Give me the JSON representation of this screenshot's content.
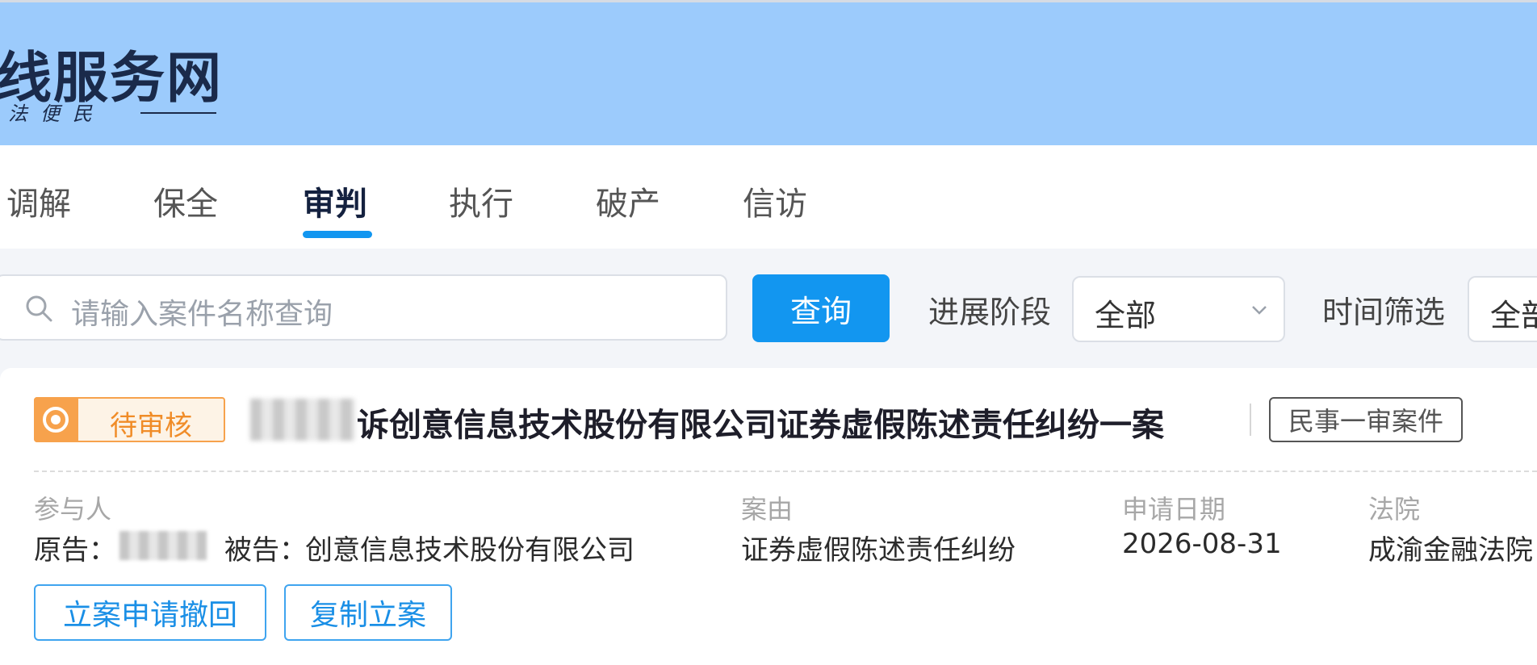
{
  "header": {
    "title": "线服务网",
    "slogan": "法便民"
  },
  "tabs": [
    {
      "label": "调解",
      "active": false
    },
    {
      "label": "保全",
      "active": false
    },
    {
      "label": "审判",
      "active": true
    },
    {
      "label": "执行",
      "active": false
    },
    {
      "label": "破产",
      "active": false
    },
    {
      "label": "信访",
      "active": false
    }
  ],
  "search": {
    "placeholder": "请输入案件名称查询",
    "button_label": "查询"
  },
  "filters": {
    "stage_label": "进展阶段",
    "stage_value": "全部",
    "time_label": "时间筛选",
    "time_value": "全部"
  },
  "case": {
    "status": "待审核",
    "title_suffix": "诉创意信息技术股份有限公司证券虚假陈述责任纠纷一案",
    "type_tag": "民事一审案件",
    "participants_label": "参与人",
    "plaintiff_label": "原告：",
    "defendant_label": "被告：",
    "defendant_value": "创意信息技术股份有限公司",
    "cause_label": "案由",
    "cause_value": "证券虚假陈述责任纠纷",
    "date_label": "申请日期",
    "date_value": "2026-08-31",
    "court_label": "法院",
    "court_value": "成渝金融法院",
    "actions": {
      "withdraw_label": "立案申请撤回",
      "copy_label": "复制立案"
    }
  },
  "colors": {
    "header_bg": "#9ccbfc",
    "accent": "#1296f0",
    "pending": "#f7a24c"
  }
}
